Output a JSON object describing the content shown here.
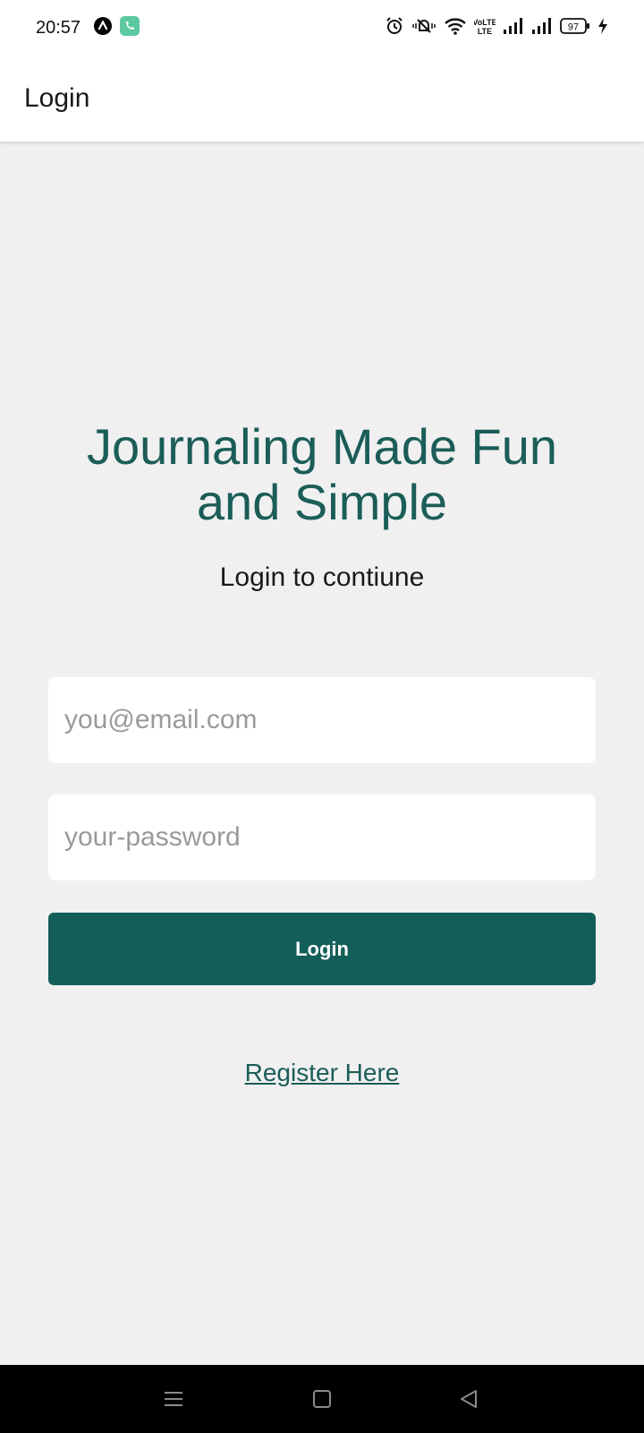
{
  "status_bar": {
    "time": "20:57",
    "battery": "97",
    "network_label": "VoLTE",
    "icons": [
      "notification-app-icon",
      "phone-call-icon",
      "alarm-icon",
      "mute-icon",
      "wifi-icon",
      "volte-icon",
      "signal-icon",
      "signal-icon",
      "battery-icon",
      "charging-icon"
    ]
  },
  "app_bar": {
    "title": "Login"
  },
  "main": {
    "headline": "Journaling Made Fun and Simple",
    "subtitle": "Login to contiune",
    "email": {
      "value": "",
      "placeholder": "you@email.com"
    },
    "password": {
      "value": "",
      "placeholder": "your-password"
    },
    "login_button": "Login",
    "register_link": "Register Here"
  },
  "nav_bar": {
    "icons": [
      "menu-icon",
      "home-icon",
      "back-icon"
    ]
  },
  "colors": {
    "accent": "#135e59",
    "background": "#f0f0f0"
  }
}
